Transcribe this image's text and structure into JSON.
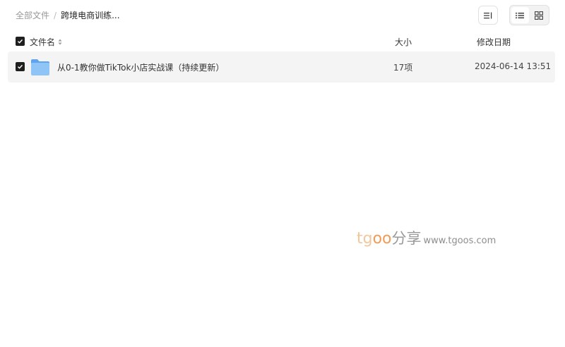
{
  "breadcrumb": {
    "root": "全部文件",
    "separator": "/",
    "current": "跨境电商训练..."
  },
  "toolbar": {
    "sort_icon": "sort-icon",
    "list_view_icon": "list-view-icon",
    "grid_view_icon": "grid-view-icon",
    "active_view": "list"
  },
  "table": {
    "headers": {
      "name": "文件名",
      "size": "大小",
      "date": "修改日期"
    },
    "rows": [
      {
        "name": "从0-1教你做TikTok小店实战课（持续更新）",
        "size": "17项",
        "date": "2024-06-14 13:51",
        "icon": "folder-icon",
        "checked": true
      }
    ]
  },
  "watermark": {
    "part1": "tg",
    "part2": "oo",
    "part3": "分享",
    "url": "www.tgoos.com"
  },
  "colors": {
    "accent_folder": "#7ab8f5",
    "checkbox": "#1f1f1f",
    "row_bg": "#f4f4f4"
  }
}
